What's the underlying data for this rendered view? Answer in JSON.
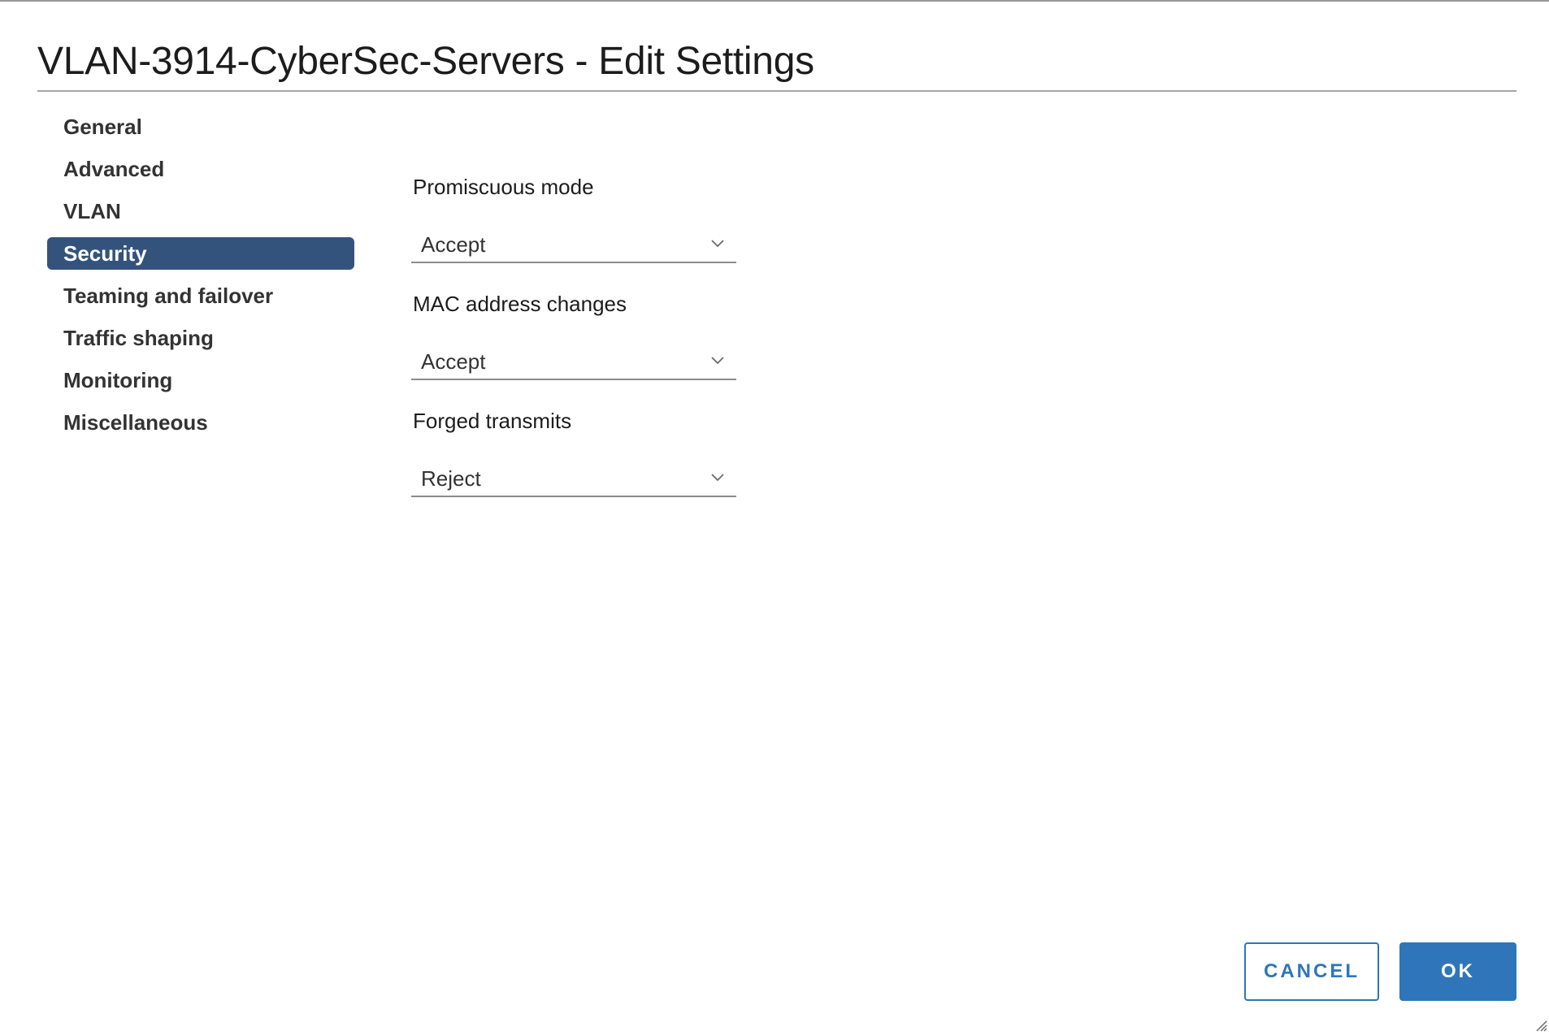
{
  "dialog": {
    "title": "VLAN-3914-CyberSec-Servers - Edit Settings"
  },
  "nav": {
    "items": [
      {
        "label": "General",
        "active": false
      },
      {
        "label": "Advanced",
        "active": false
      },
      {
        "label": "VLAN",
        "active": false
      },
      {
        "label": "Security",
        "active": true
      },
      {
        "label": "Teaming and failover",
        "active": false
      },
      {
        "label": "Traffic shaping",
        "active": false
      },
      {
        "label": "Monitoring",
        "active": false
      },
      {
        "label": "Miscellaneous",
        "active": false
      }
    ]
  },
  "security": {
    "promiscuous_mode": {
      "label": "Promiscuous mode",
      "value": "Accept"
    },
    "mac_address_changes": {
      "label": "MAC address changes",
      "value": "Accept"
    },
    "forged_transmits": {
      "label": "Forged transmits",
      "value": "Reject"
    }
  },
  "footer": {
    "cancel_label": "CANCEL",
    "ok_label": "OK"
  },
  "colors": {
    "nav_active_bg": "#34537c",
    "primary": "#2e76b9"
  },
  "icons": {
    "dropdown": "chevron-down-icon",
    "resize": "resize-grip-icon"
  }
}
